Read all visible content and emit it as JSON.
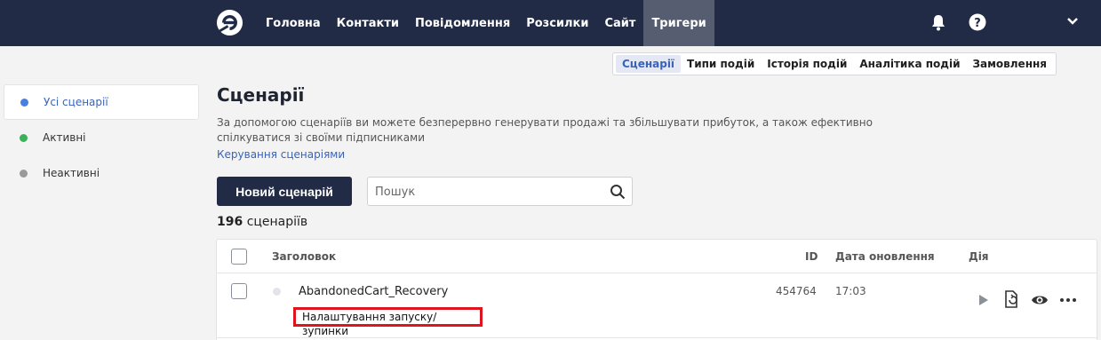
{
  "nav": {
    "items": [
      {
        "label": "Головна",
        "active": false
      },
      {
        "label": "Контакти",
        "active": false
      },
      {
        "label": "Повідомлення",
        "active": false
      },
      {
        "label": "Розсилки",
        "active": false
      },
      {
        "label": "Сайт",
        "active": false
      },
      {
        "label": "Тригери",
        "active": true
      }
    ]
  },
  "subtabs": {
    "items": [
      {
        "label": "Сценарії",
        "active": true
      },
      {
        "label": "Типи подій",
        "active": false
      },
      {
        "label": "Історія подій",
        "active": false
      },
      {
        "label": "Аналітика подій",
        "active": false
      },
      {
        "label": "Замовлення",
        "active": false
      }
    ]
  },
  "sidebar": {
    "items": [
      {
        "label": "Усі сценарії",
        "color": "#4a7fe0",
        "active": true
      },
      {
        "label": "Активні",
        "color": "#3bb25a",
        "active": false
      },
      {
        "label": "Неактивні",
        "color": "#9a9a9a",
        "active": false
      }
    ]
  },
  "main": {
    "title": "Сценарії",
    "description": "За допомогою сценаріїв ви можете безперервно генерувати продажі та збільшувати прибуток, а також ефективно спілкуватися зі своїми підписниками",
    "manage_link": "Керування сценаріями",
    "new_button": "Новий сценарій",
    "search_placeholder": "Пошук",
    "count_number": "196",
    "count_label": "сценаріїв"
  },
  "table": {
    "headers": {
      "title": "Заголовок",
      "id": "ID",
      "updated": "Дата оновлення",
      "action": "Дія"
    },
    "rows": [
      {
        "name": "AbandonedCart_Recovery",
        "id": "454764",
        "updated": "17:03",
        "sublink": "Налаштування запуску/зупинки"
      }
    ]
  },
  "colors": {
    "navbar": "#212b45",
    "accent": "#3a63b8",
    "highlight": "#e0141e"
  },
  "icons": [
    "logo-icon",
    "bell-icon",
    "help-icon",
    "chevron-down-icon",
    "search-icon",
    "play-icon",
    "copy-icon",
    "eye-icon",
    "more-icon"
  ]
}
